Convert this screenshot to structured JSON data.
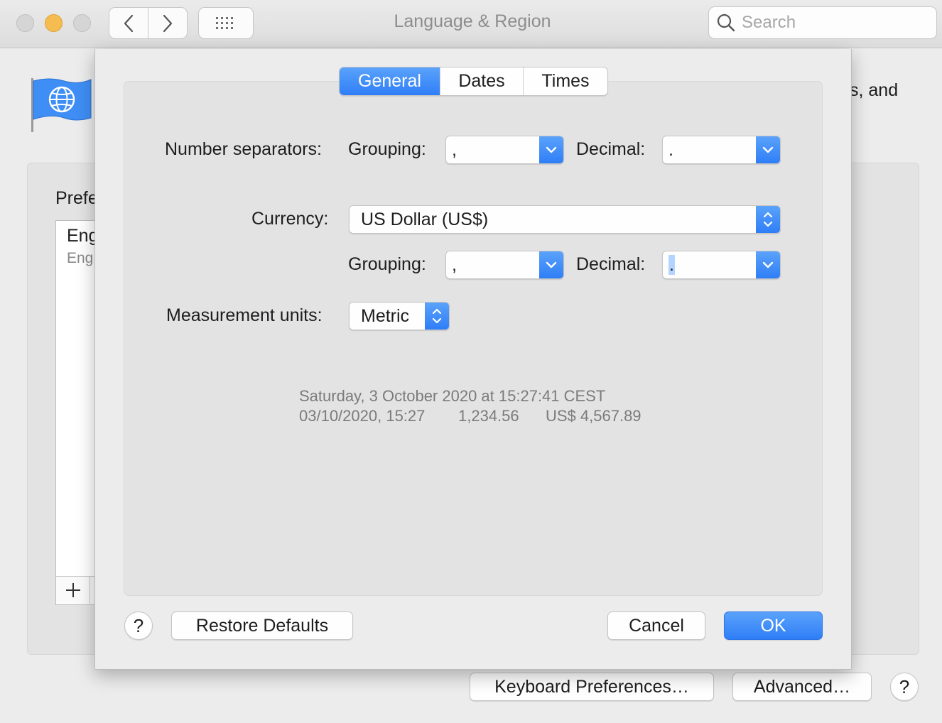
{
  "window": {
    "title": "Language & Region",
    "search_placeholder": "Search"
  },
  "background": {
    "description_fragment": "s, and",
    "preferred_label": "Prefe",
    "list_primary": "Eng",
    "list_secondary": "Eng",
    "add_label": "+",
    "keyboard_button": "Keyboard Preferences…",
    "advanced_button": "Advanced…",
    "help_label": "?"
  },
  "sheet": {
    "tabs": [
      "General",
      "Dates",
      "Times"
    ],
    "active_tab": "General",
    "number_separators_label": "Number separators:",
    "grouping_label": "Grouping:",
    "decimal_label": "Decimal:",
    "number_grouping_value": ",",
    "number_decimal_value": ".",
    "currency_label": "Currency:",
    "currency_value": "US Dollar (US$)",
    "currency_grouping_label": "Grouping:",
    "currency_decimal_label": "Decimal:",
    "currency_grouping_value": ",",
    "currency_decimal_value": ".",
    "measurement_label": "Measurement units:",
    "measurement_value": "Metric",
    "sample_line1": "Saturday, 3 October 2020 at 15:27:41 CEST",
    "sample_date": "03/10/2020, 15:27",
    "sample_number": "1,234.56",
    "sample_currency": "US$ 4,567.89",
    "help_label": "?",
    "restore_button": "Restore Defaults",
    "cancel_button": "Cancel",
    "ok_button": "OK"
  },
  "colors": {
    "accent": "#2f7ef7",
    "traffic_minimize": "#f5bd4f",
    "flag_blue": "#3f8ef5"
  }
}
